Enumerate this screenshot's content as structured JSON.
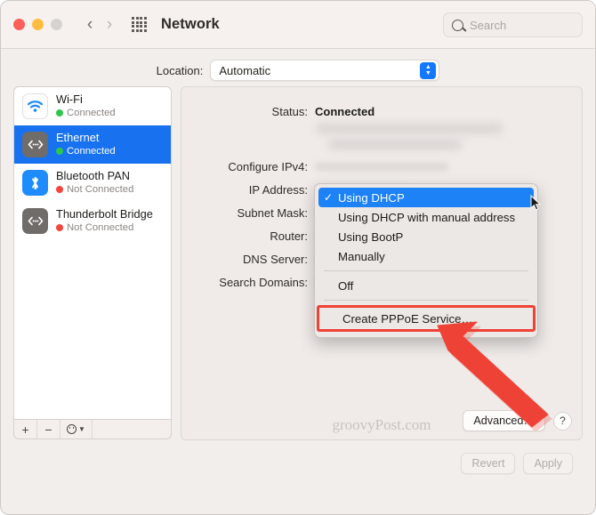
{
  "window": {
    "title": "Network",
    "traffic_lights": [
      "close",
      "minimize",
      "zoom"
    ],
    "back_icon": "chevron-left-icon",
    "forward_icon": "chevron-right-icon",
    "grid_icon": "grid-apps-icon"
  },
  "search": {
    "placeholder": "Search",
    "value": "",
    "icon": "search-icon"
  },
  "location": {
    "label": "Location:",
    "value": "Automatic",
    "stepper_icon": "chevron-up-down-icon"
  },
  "sidebar": {
    "interfaces": [
      {
        "name": "Wi-Fi",
        "status": "Connected",
        "state": "connected",
        "icon": "wifi-icon",
        "selected": false
      },
      {
        "name": "Ethernet",
        "status": "Connected",
        "state": "connected",
        "icon": "ethernet-icon",
        "selected": true
      },
      {
        "name": "Bluetooth PAN",
        "status": "Not Connected",
        "state": "disconnected",
        "icon": "bluetooth-icon",
        "selected": false
      },
      {
        "name": "Thunderbolt Bridge",
        "status": "Not Connected",
        "state": "disconnected",
        "icon": "ethernet-icon",
        "selected": false
      }
    ],
    "toolbar": {
      "add_label": "+",
      "remove_label": "−",
      "action_icon": "gear-action-icon",
      "action_chevron": "chevron-down-icon"
    }
  },
  "detail": {
    "status_label": "Status:",
    "status_value": "Connected",
    "fields": [
      {
        "label": "Configure IPv4:",
        "value": ""
      },
      {
        "label": "IP Address:",
        "value": ""
      },
      {
        "label": "Subnet Mask:",
        "value": ""
      },
      {
        "label": "Router:",
        "value": ""
      },
      {
        "label": "DNS Server:",
        "value": ""
      },
      {
        "label": "Search Domains:",
        "value": ""
      }
    ],
    "watermark": "groovyPost.com",
    "advanced_label": "Advanced…",
    "help_label": "?"
  },
  "dropdown": {
    "items": [
      {
        "label": "Using DHCP",
        "checked": true,
        "highlighted": true
      },
      {
        "label": "Using DHCP with manual address",
        "checked": false,
        "highlighted": false
      },
      {
        "label": "Using BootP",
        "checked": false,
        "highlighted": false
      },
      {
        "label": "Manually",
        "checked": false,
        "highlighted": false
      },
      {
        "label": "Off",
        "checked": false,
        "highlighted": false
      },
      {
        "label": "Create PPPoE Service…",
        "checked": false,
        "highlighted": false,
        "annotated": true
      }
    ],
    "check_glyph": "✓"
  },
  "footer": {
    "revert_label": "Revert",
    "apply_label": "Apply"
  },
  "annotation": {
    "color": "#ef4237",
    "arrow_icon": "pointer-arrow-icon",
    "cursor_icon": "mouse-cursor-icon"
  }
}
